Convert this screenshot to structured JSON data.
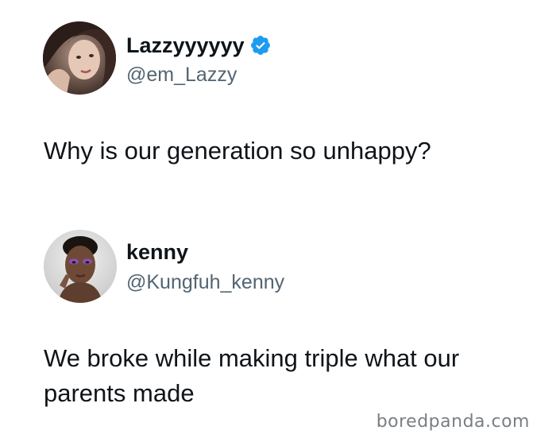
{
  "tweets": [
    {
      "display_name": "Lazzyyyyyy",
      "handle": "@em_Lazzy",
      "verified": true,
      "avatar_icon": "profile-photo-woman",
      "text": "Why is our generation so unhappy?"
    },
    {
      "display_name": "kenny",
      "handle": "@Kungfuh_kenny",
      "verified": false,
      "avatar_icon": "profile-photo-man",
      "text": "We broke while making triple what our parents made"
    }
  ],
  "watermark": "boredpanda.com",
  "colors": {
    "verified_blue": "#1d9bf0",
    "handle_gray": "#536471",
    "text": "#0f1419"
  }
}
